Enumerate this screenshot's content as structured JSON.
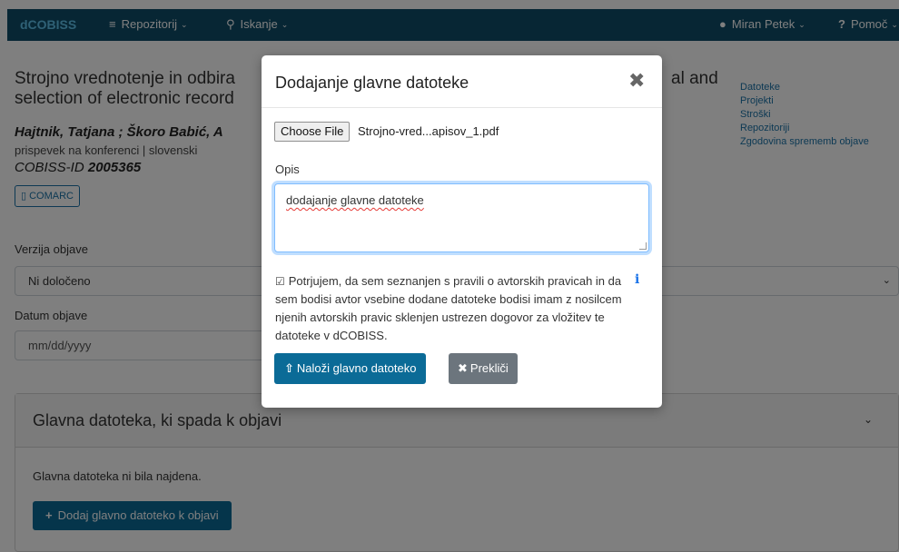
{
  "navbar": {
    "brand": "dCOBISS",
    "repozitorij": "Repozitorij",
    "iskanje": "Iskanje",
    "user": "Miran Petek",
    "pomoc": "Pomoč",
    "icons": {
      "repozitorij": "database-icon",
      "iskanje": "search-icon",
      "user": "user-icon",
      "pomoc": "question-icon",
      "chevron": "chevron-down-icon"
    }
  },
  "publication": {
    "title_line1": "Strojno vrednotenje in odbira",
    "title_line1_end": "al and",
    "title_line2": "selection of electronic record",
    "authors": "Hajtnik, Tatjana ; Škoro Babić, A",
    "meta": "prispevek na konferenci | slovenski",
    "cobiss_prefix": "COBISS-ID",
    "cobiss_id": "2005365",
    "comarc_label": "COMARC"
  },
  "sidebar": {
    "links": [
      "Datoteke",
      "Projekti",
      "Stroški",
      "Repozitoriji",
      "Zgodovina sprememb objave"
    ]
  },
  "form": {
    "version_label": "Verzija objave",
    "version_value": "Ni določeno",
    "date_label": "Datum objave",
    "date_placeholder": "mm/dd/yyyy"
  },
  "main_file_card": {
    "title": "Glavna datoteka, ki spada k objavi",
    "empty_message": "Glavna datoteka ni bila najdena.",
    "add_button": "Dodaj glavno datoteko k objavi"
  },
  "modal": {
    "title": "Dodajanje glavne datoteke",
    "choose_file_label": "Choose File",
    "file_name": "Strojno-vred...apisov_1.pdf",
    "opis_label": "Opis",
    "opis_value": "dodajanje glavne datoteke",
    "consent_text": "Potrjujem, da sem seznanjen s pravili o avtorskih pravicah in da sem bodisi avtor vsebine dodane datoteke bodisi imam z nosilcem njenih avtorskih pravic sklenjen ustrezen dogovor za vložitev te datoteke v dCOBISS.",
    "upload_button": "Naloži glavno datoteko",
    "cancel_button": "Prekliči"
  },
  "colors": {
    "navbar": "#0f4c68",
    "brand": "#5fc3ec",
    "primary_button": "#0b6b97",
    "secondary_button": "#6c757d",
    "link": "#1a73a8"
  }
}
